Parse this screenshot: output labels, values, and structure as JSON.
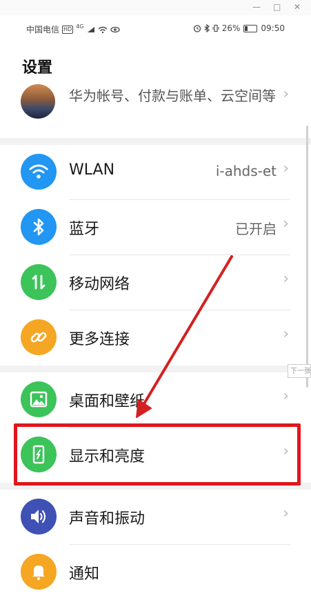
{
  "window": {
    "minimize": "—",
    "maximize": "□",
    "close": "✕"
  },
  "status_bar": {
    "carrier": "中国电信",
    "hd": "HD",
    "network": "4G",
    "battery": "26%",
    "time": "09:50"
  },
  "page": {
    "title": "设置"
  },
  "account": {
    "text": "华为帐号、付款与账单、云空间等"
  },
  "settings": [
    {
      "label": "WLAN",
      "value": "i-ahds-et",
      "icon": "wifi-icon",
      "color": "#2196f3"
    },
    {
      "label": "蓝牙",
      "value": "已开启",
      "icon": "bluetooth-icon",
      "color": "#2196f3"
    },
    {
      "label": "移动网络",
      "value": "",
      "icon": "mobile-data-icon",
      "color": "#3cc35a"
    },
    {
      "label": "更多连接",
      "value": "",
      "icon": "link-icon",
      "color": "#f5a623"
    },
    {
      "label": "桌面和壁纸",
      "value": "",
      "icon": "wallpaper-icon",
      "color": "#3cc35a"
    },
    {
      "label": "显示和亮度",
      "value": "",
      "icon": "display-icon",
      "color": "#3cc35a"
    },
    {
      "label": "声音和振动",
      "value": "",
      "icon": "sound-icon",
      "color": "#3f51b5"
    },
    {
      "label": "通知",
      "value": "",
      "icon": "notification-icon",
      "color": "#f5a623"
    }
  ],
  "next_tip": "下一张",
  "colors": {
    "highlight": "#e0161c",
    "arrow": "#d42020"
  }
}
